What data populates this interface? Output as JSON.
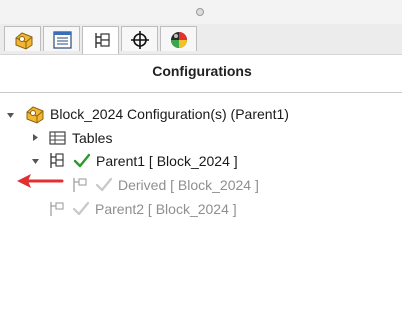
{
  "panel": {
    "title": "Configurations"
  },
  "tabs": [
    {
      "name": "feature-manager",
      "icon": "feature-manager-icon"
    },
    {
      "name": "property-manager",
      "icon": "property-manager-icon"
    },
    {
      "name": "configuration-manager",
      "icon": "configuration-manager-icon",
      "active": true
    },
    {
      "name": "dimxpert-manager",
      "icon": "crosshair-icon"
    },
    {
      "name": "display-manager",
      "icon": "appearance-sphere-icon"
    }
  ],
  "tree": {
    "root_label": "Block_2024 Configuration(s)  (Parent1)",
    "tables_label": "Tables",
    "parent1_label": "Parent1 [ Block_2024 ]",
    "derived_label": "Derived [ Block_2024 ]",
    "parent2_label": "Parent2 [ Block_2024 ]"
  },
  "colors": {
    "active_check": "#2a9a2a",
    "inactive_check": "#c8c8c8",
    "annotation_arrow": "#e03030",
    "part_icon": "#f2b632"
  }
}
